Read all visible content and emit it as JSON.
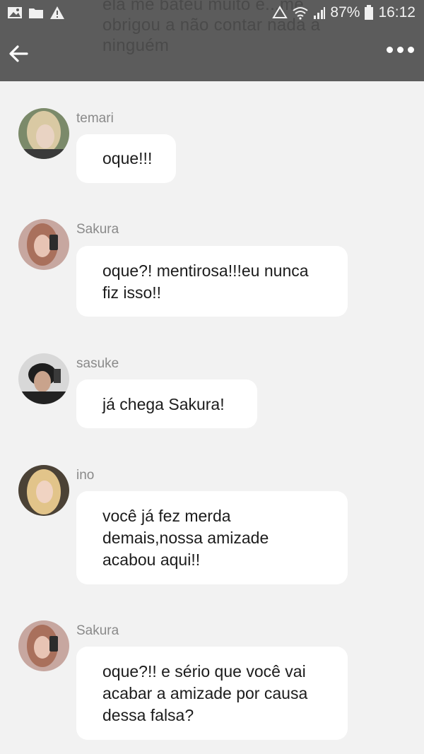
{
  "header": {
    "preview_text": "ela me bateu muito e...me obrigou a não contar nada a ninguém",
    "back_icon": "arrow-left-icon",
    "more_icon": "more-horizontal-icon"
  },
  "status_bar": {
    "battery": "87%",
    "time": "16:12",
    "left_icons": [
      "image-icon",
      "folder-icon",
      "warning-icon"
    ],
    "right_icons": [
      "recycle-icon",
      "wifi-icon",
      "signal-icon",
      "battery-icon"
    ]
  },
  "messages": [
    {
      "sender": "temari",
      "text": "oque!!!"
    },
    {
      "sender": "Sakura",
      "text": "oque?! mentirosa!!!eu nunca fiz isso!!"
    },
    {
      "sender": "sasuke",
      "text": "já chega Sakura!"
    },
    {
      "sender": "ino",
      "text": "você já fez merda demais,nossa amizade acabou aqui!!"
    },
    {
      "sender": "Sakura",
      "text": "oque?!! e sério que você vai acabar a amizade por causa dessa falsa?"
    }
  ],
  "colors": {
    "topbar": "#5c5c5c",
    "background": "#f2f2f2",
    "bubble": "#ffffff",
    "name": "#8a8a8a"
  }
}
